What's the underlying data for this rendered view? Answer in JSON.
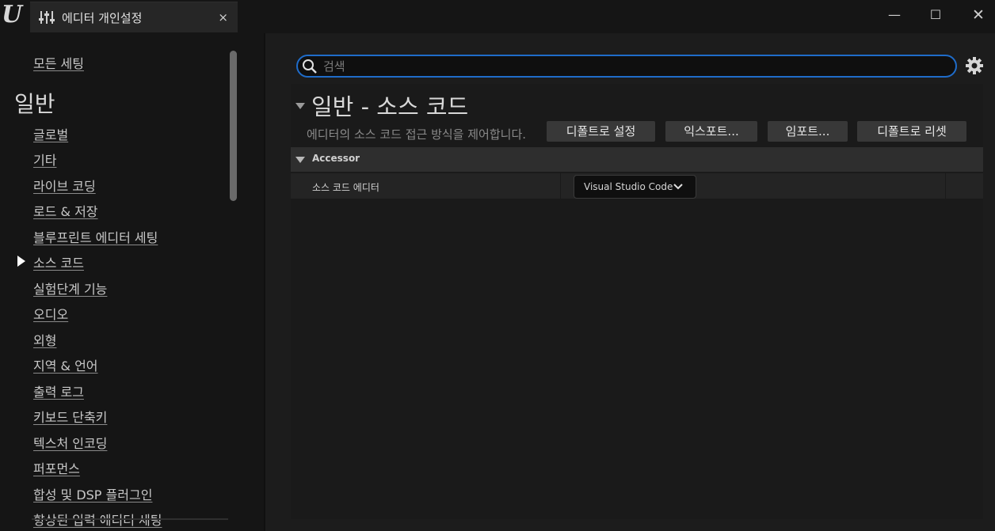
{
  "window": {
    "tab_title": "에디터 개인설정",
    "close_glyph": "×",
    "minimize_glyph": "—",
    "maximize_glyph": "☐",
    "window_close_glyph": "✕",
    "logo_text": "U"
  },
  "sidebar": {
    "top_item": "모든 세팅",
    "section_title": "일반",
    "items": [
      {
        "label": "글로벌"
      },
      {
        "label": "기타"
      },
      {
        "label": "라이브 코딩"
      },
      {
        "label": "로드 & 저장"
      },
      {
        "label": "블루프린트 에디터 세팅"
      },
      {
        "label": "소스 코드",
        "active": true
      },
      {
        "label": "실험단계 기능"
      },
      {
        "label": "오디오"
      },
      {
        "label": "외형"
      },
      {
        "label": "지역 & 언어"
      },
      {
        "label": "출력 로그"
      },
      {
        "label": "키보드 단축키"
      },
      {
        "label": "텍스처 인코딩"
      },
      {
        "label": "퍼포먼스"
      },
      {
        "label": "합성 및 DSP 플러그인"
      },
      {
        "label": "향상된 입력 에디터 세팅"
      }
    ]
  },
  "search": {
    "placeholder": "검색",
    "value": ""
  },
  "section": {
    "title": "일반 - 소스 코드",
    "description": "에디터의 소스 코드 접근 방식을 제어합니다.",
    "buttons": {
      "set_default": "디폴트로 설정",
      "export": "익스포트...",
      "import": "임포트...",
      "reset_default": "디폴트로 리셋"
    }
  },
  "category": {
    "label": "Accessor",
    "properties": [
      {
        "name": "소스 코드 에디터",
        "value": "Visual Studio Code"
      }
    ]
  },
  "icons": {
    "logo": "unreal-logo-icon",
    "tab": "settings-sliders-icon",
    "search": "search-icon",
    "gear": "gear-icon",
    "chevron": "chevron-down-icon"
  },
  "colors": {
    "accent": "#1f6cc9",
    "background": "#151515",
    "panel": "#1c1c1c"
  }
}
